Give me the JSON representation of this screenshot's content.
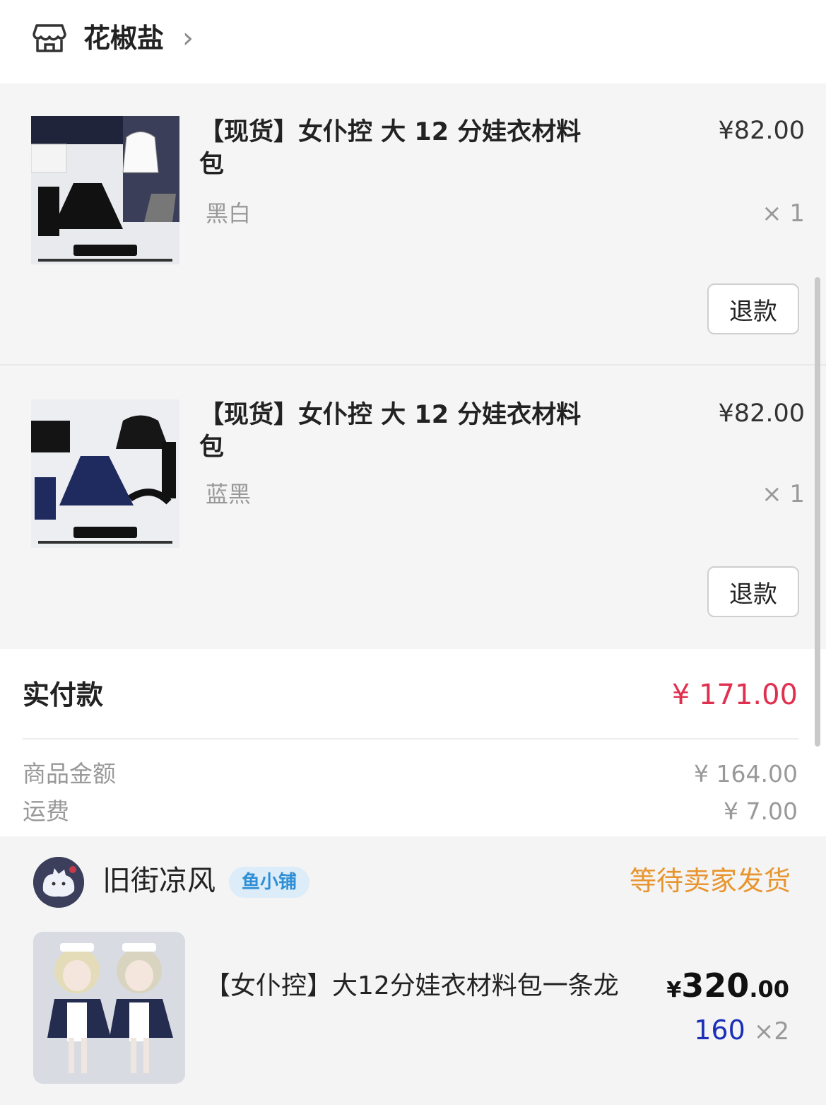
{
  "header": {
    "shop_name": "花椒盐",
    "chevron": "›",
    "shop_icon": "store-icon"
  },
  "items": [
    {
      "title": "【现货】女仆控 大 12 分娃衣材料包",
      "price": "¥82.00",
      "variant": "黑白",
      "qty": "× 1",
      "refund_label": "退款"
    },
    {
      "title": "【现货】女仆控 大 12 分娃衣材料包",
      "price": "¥82.00",
      "variant": "蓝黑",
      "qty": "× 1",
      "refund_label": "退款"
    }
  ],
  "totals": {
    "paid_label": "实付款",
    "paid_value": "¥ 171.00",
    "goods_label": "商品金额",
    "goods_value": "¥ 164.00",
    "shipping_label": "运费",
    "shipping_value": "¥ 7.00"
  },
  "order2": {
    "seller_name": "旧街凉风",
    "seller_badge": "鱼小铺",
    "status": "等待卖家发货",
    "product_title": "【女仆控】大12分娃衣材料包一条龙",
    "price_currency": "¥",
    "price_int": "320",
    "price_dec": ".00",
    "unit_price": "160",
    "quantity": "×2"
  },
  "colors": {
    "accent_red": "#e0304f",
    "status_orange": "#e8952f",
    "badge_blue": "#2f8fd6"
  }
}
